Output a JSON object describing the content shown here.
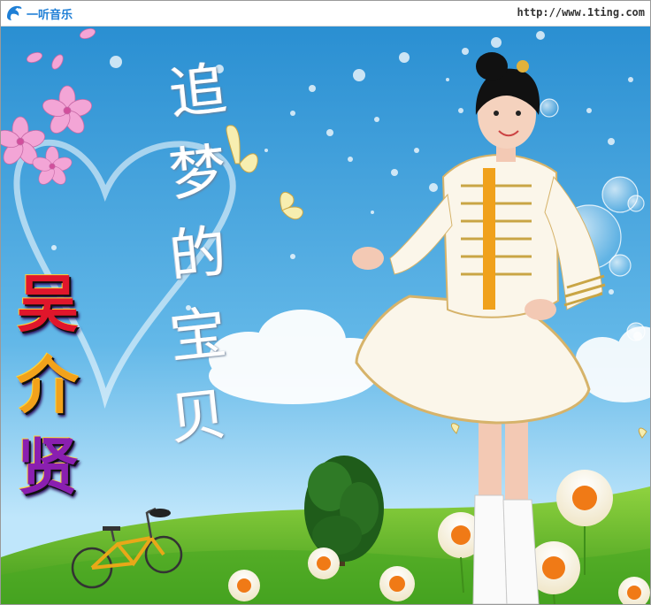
{
  "header": {
    "logo_text": "一听音乐",
    "site_url": "http://www.1ting.com"
  },
  "cover": {
    "album_title_chars": [
      "追",
      "梦",
      "的",
      "宝",
      "贝"
    ],
    "artist_chars": [
      "吴",
      "介",
      "贤"
    ]
  },
  "colors": {
    "sky_top": "#2f9ad8",
    "sky_bottom": "#bfe6fb",
    "grass": "#6fc22e",
    "logo_blue": "#1f7fd6"
  },
  "icons": [
    "dolphin-logo-icon"
  ]
}
